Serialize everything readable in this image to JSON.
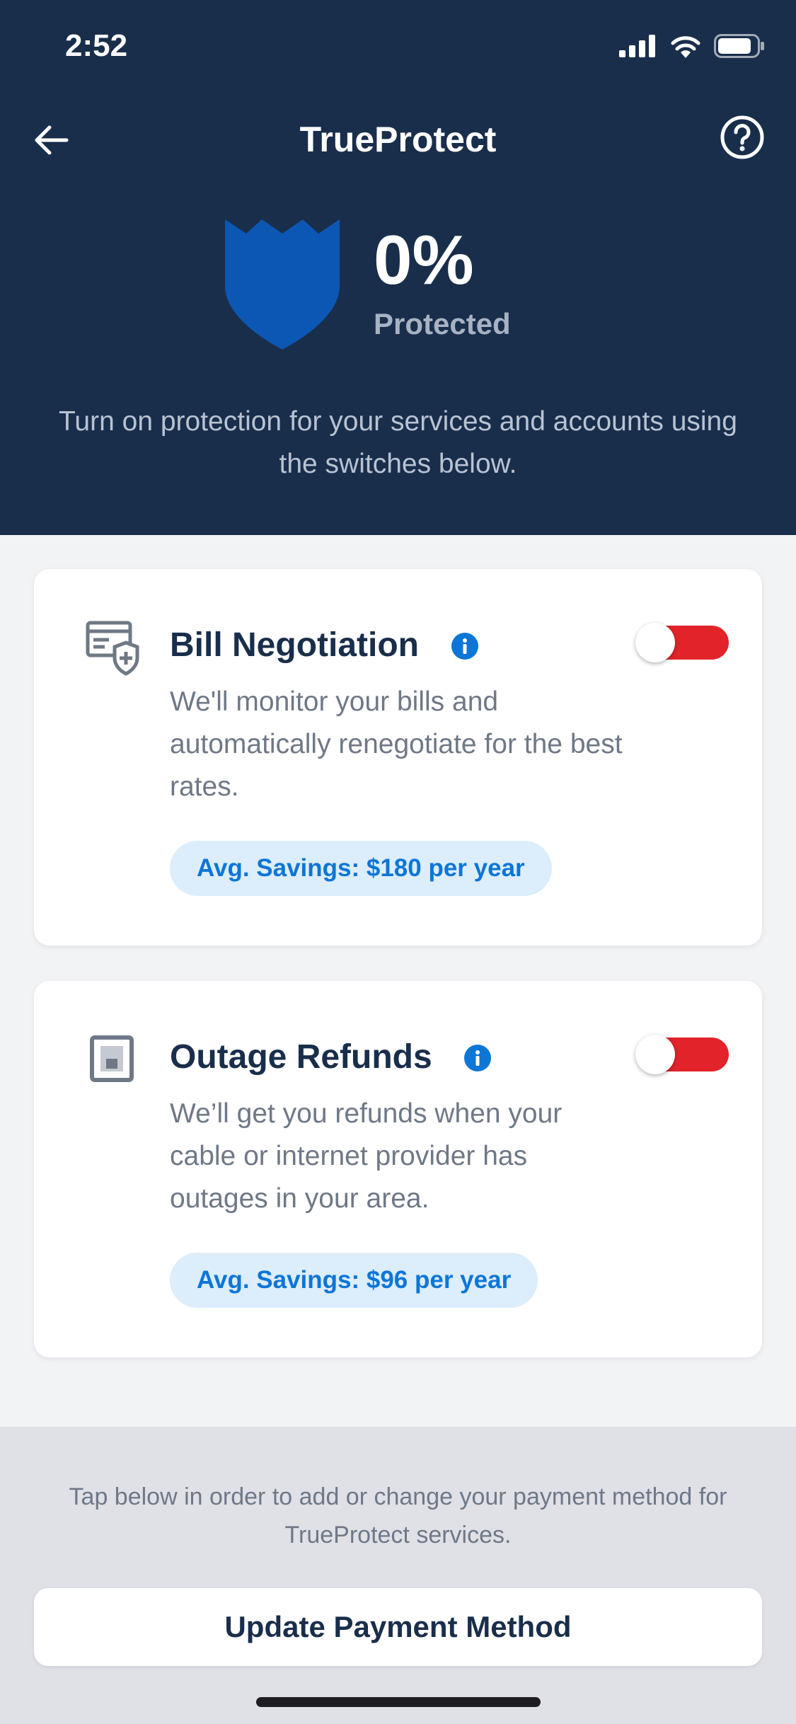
{
  "status": {
    "time": "2:52"
  },
  "header": {
    "title": "TrueProtect",
    "back_icon": "back-arrow-icon",
    "help_icon": "help-circle-icon"
  },
  "protection": {
    "percent": "0%",
    "label": "Protected",
    "description": "Turn on protection for your services and accounts using the switches below."
  },
  "services": [
    {
      "title": "Bill Negotiation",
      "description": "We'll monitor your bills and automatically renegotiate for the best rates.",
      "savings": "Avg. Savings: $180 per year",
      "enabled": false,
      "icon": "bill-shield-icon"
    },
    {
      "title": "Outage Refunds",
      "description": "We’ll get you refunds when your cable or internet provider has outages in your area.",
      "savings": "Avg. Savings: $96 per year",
      "enabled": false,
      "icon": "device-icon"
    }
  ],
  "footer": {
    "text": "Tap below in order to add or change your payment method for TrueProtect services.",
    "button_label": "Update Payment Method"
  },
  "colors": {
    "navy": "#192e4b",
    "shield": "#0c57b4",
    "toggle_off": "#e2232a",
    "badge_text": "#0d76d6",
    "badge_bg": "#dcedfb"
  }
}
